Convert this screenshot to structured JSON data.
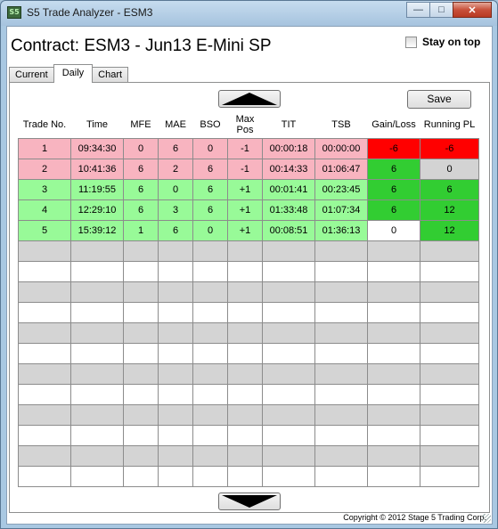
{
  "window": {
    "title": "S5 Trade Analyzer - ESM3",
    "icon_text": "S5",
    "minimize_glyph": "—",
    "maximize_glyph": "□",
    "close_glyph": "✕"
  },
  "header": {
    "contract_title": "Contract: ESM3 - Jun13 E-Mini SP",
    "stay_on_top_label": "Stay on top",
    "stay_on_top_checked": false
  },
  "tabs": [
    {
      "label": "Current",
      "active": false
    },
    {
      "label": "Daily",
      "active": true
    },
    {
      "label": "Chart",
      "active": false
    }
  ],
  "toolbar": {
    "save_label": "Save"
  },
  "table": {
    "headers": [
      "Trade No.",
      "Time",
      "MFE",
      "MAE",
      "BSO",
      "Max Pos",
      "TIT",
      "TSB",
      "Gain/Loss",
      "Running PL"
    ],
    "rows": [
      {
        "trade_no": "1",
        "time": "09:34:30",
        "mfe": "0",
        "mae": "6",
        "bso": "0",
        "max_pos": "-1",
        "tit": "00:00:18",
        "tsb": "00:00:00",
        "gain_loss": "-6",
        "running_pl": "-6"
      },
      {
        "trade_no": "2",
        "time": "10:41:36",
        "mfe": "6",
        "mae": "2",
        "bso": "6",
        "max_pos": "-1",
        "tit": "00:14:33",
        "tsb": "01:06:47",
        "gain_loss": "6",
        "running_pl": "0"
      },
      {
        "trade_no": "3",
        "time": "11:19:55",
        "mfe": "6",
        "mae": "0",
        "bso": "6",
        "max_pos": "+1",
        "tit": "00:01:41",
        "tsb": "00:23:45",
        "gain_loss": "6",
        "running_pl": "6"
      },
      {
        "trade_no": "4",
        "time": "12:29:10",
        "mfe": "6",
        "mae": "3",
        "bso": "6",
        "max_pos": "+1",
        "tit": "01:33:48",
        "tsb": "01:07:34",
        "gain_loss": "6",
        "running_pl": "12"
      },
      {
        "trade_no": "5",
        "time": "15:39:12",
        "mfe": "1",
        "mae": "6",
        "bso": "0",
        "max_pos": "+1",
        "tit": "00:08:51",
        "tsb": "01:36:13",
        "gain_loss": "0",
        "running_pl": "12"
      }
    ]
  },
  "footer": {
    "copyright": "Copyright © 2012 Stage 5 Trading Corp."
  },
  "colors": {
    "loss_row": "#f8b4c0",
    "win_row": "#98fa98",
    "gain_red": "#ff0000",
    "gain_green": "#32cd32"
  }
}
